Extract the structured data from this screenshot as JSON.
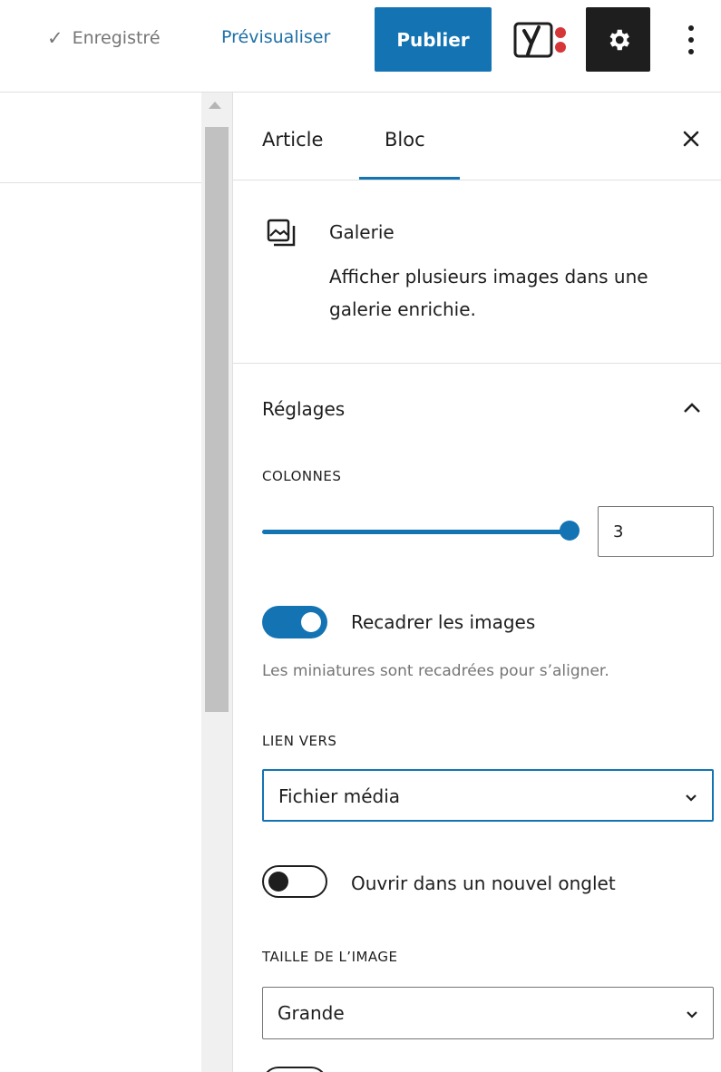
{
  "header": {
    "saved_label": "Enregistré",
    "preview_label": "Prévisualiser",
    "publish_label": "Publier",
    "accent_color": "#1474b3"
  },
  "sidebar": {
    "tabs": [
      {
        "label": "Article",
        "active": false
      },
      {
        "label": "Bloc",
        "active": true
      }
    ],
    "block": {
      "title": "Galerie",
      "description": "Afficher plusieurs images dans une galerie enrichie."
    },
    "settings": {
      "title": "Réglages",
      "columns_label": "COLONNES",
      "columns_value": "3",
      "columns_slider_level": 1.0,
      "crop_label": "Recadrer les images",
      "crop_enabled": true,
      "crop_help": "Les miniatures sont recadrées pour s’aligner.",
      "link_label": "LIEN VERS",
      "link_value": "Fichier média",
      "new_tab_label": "Ouvrir dans un nouvel onglet",
      "new_tab_enabled": false,
      "size_label": "TAILLE DE L’IMAGE",
      "size_value": "Grande"
    }
  }
}
